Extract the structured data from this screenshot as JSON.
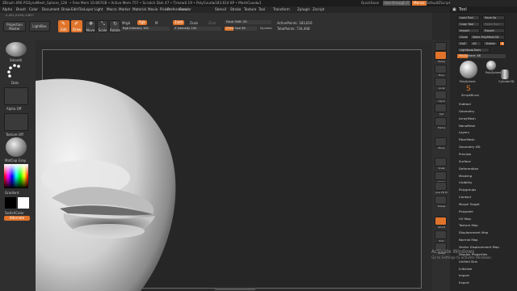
{
  "titlebar": {
    "app": "ZBrush 4R6 P1",
    "doc": "DynaMesh_Sphere_128",
    "mem": "• Free Mem 10.867GB • Active Mem 757 • Scratch Disk 47 • Timer▸0.19 • PolyCount▸183.614 KP • MeshCount▸1",
    "quicksave": "QuickSave",
    "seethrough": "See-through  0",
    "menus_btn": "Menus",
    "script": "DefaultZScript"
  },
  "menubar": [
    "Alpha",
    "Brush",
    "Color",
    "Document",
    "Draw",
    "Edit",
    "File",
    "Layer",
    "Light",
    "Macro",
    "Marker",
    "Material",
    "Movie",
    "Picker",
    "Preferences",
    "Render",
    "Stencil",
    "Stroke",
    "Texture",
    "Tool",
    "Transform",
    "Zplugin",
    "Zscript"
  ],
  "coords": "-0.451,0.094,-0.857",
  "toolbar": {
    "projection": "Projection Master",
    "lightbox": "LightBox",
    "edit": "Edit",
    "draw": "Draw",
    "move": "Move",
    "scale": "Scale",
    "rotate": "Rotate",
    "mrgb": "Mrgb",
    "rgb": "Rgb",
    "m": "M",
    "rgb_intensity": "Rgb Intensity 100",
    "zadd": "Zadd",
    "zsub": "Zsub",
    "zcut": "Zcut",
    "z_intensity": "Z Intensity 100",
    "focal_shift": "Focal Shift -55",
    "draw_size": "Draw Size 56",
    "dynamic": "Dynamic",
    "active_points": "ActivePoints: 183,616",
    "total_points": "TotalPoints: 734,408"
  },
  "leftshelf": {
    "brush": "Smooth",
    "stroke": "Dots",
    "alpha": "Alpha Off",
    "texture": "Texture Off",
    "material": "MatCap Gray",
    "gradient": "Gradient",
    "switchcolor": "SwitchColor",
    "alternate": "Alternate"
  },
  "rightshelf": [
    "SPix 3",
    "Persp",
    "Floor",
    "Local",
    "LSym",
    "Xyz",
    "Frame",
    "Move",
    "Scale",
    "Rotate",
    "Line Fill PolyF",
    "Transp",
    "Ghost",
    "Solo",
    "Xpose"
  ],
  "toolpanel": {
    "title": "Tool",
    "load_tool": "Load Tool",
    "save_as": "Save As",
    "copy_tool": "Copy Tool",
    "paste_tool": "Paste Tool",
    "import": "Import",
    "export": "Export",
    "clone": "Clone",
    "make_polymesh": "Make PolyMesh3D",
    "goz": "GoZ",
    "all": "All",
    "visible": "Visible",
    "r": "R",
    "lightbox_tools": "Lightbox▸Tools",
    "polysphere_label": "PolySphere: 46",
    "thumb_labels": [
      "PolySphere",
      "PolySphere",
      "Cylinder3D",
      "SimpleBrush"
    ],
    "subtools": [
      "Subtool",
      "Geometry",
      "ArrayMesh",
      "NanoMesh",
      "Layers",
      "FiberMesh",
      "Geometry HD",
      "Preview",
      "Surface",
      "Deformation",
      "Masking",
      "Visibility",
      "Polygroups",
      "Contact",
      "Morph Target",
      "Polypaint",
      "UV Map",
      "Texture Map",
      "Displacement Map",
      "Normal Map",
      "Vector Displacement Map",
      "Display Properties",
      "Unified Skin",
      "Initialize",
      "Import",
      "Export"
    ]
  },
  "watermark": {
    "line1": "Activate Windows",
    "line2": "Go to Settings to activate Windows."
  },
  "colors": {
    "accent": "#e0742b",
    "bg": "#2a2a2a",
    "panel": "#262626"
  }
}
